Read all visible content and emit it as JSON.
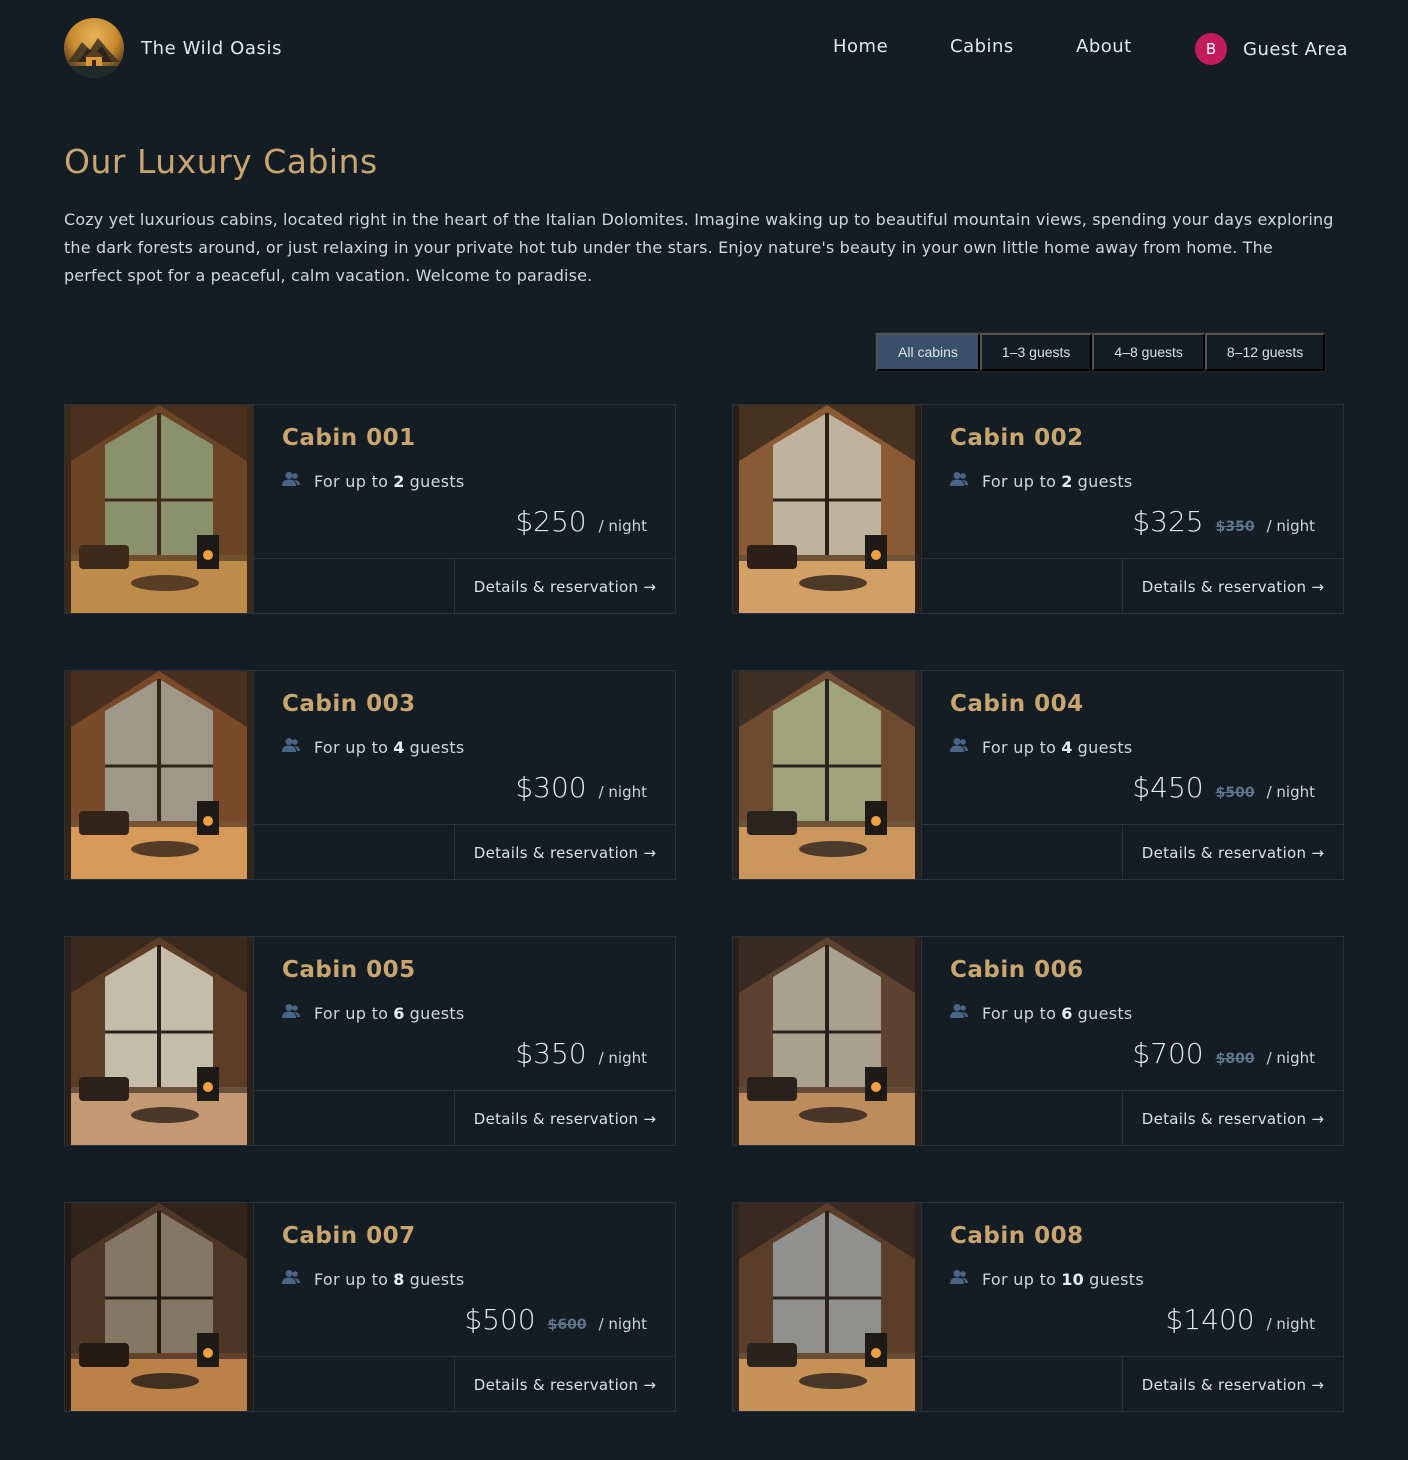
{
  "header": {
    "brand": "The Wild Oasis",
    "nav": [
      "Home",
      "Cabins",
      "About"
    ],
    "avatar_initial": "B",
    "guest_area": "Guest Area"
  },
  "main": {
    "title": "Our Luxury Cabins",
    "intro": "Cozy yet luxurious cabins, located right in the heart of the Italian Dolomites. Imagine waking up to beautiful mountain views, spending your days exploring the dark forests around, or just relaxing in your private hot tub under the stars. Enjoy nature's beauty in your own little home away from home. The perfect spot for a peaceful, calm vacation. Welcome to paradise."
  },
  "filter": {
    "options": [
      "All cabins",
      "1–3 guests",
      "4–8 guests",
      "8–12 guests"
    ],
    "active": "All cabins"
  },
  "labels": {
    "capacity_prefix": "For up to",
    "capacity_suffix": "guests",
    "per_night": "/ night",
    "details": "Details & reservation →"
  },
  "cabins": [
    {
      "name": "Cabin 001",
      "max_guests": "2",
      "price": "$250",
      "old_price": ""
    },
    {
      "name": "Cabin 002",
      "max_guests": "2",
      "price": "$325",
      "old_price": "$350"
    },
    {
      "name": "Cabin 003",
      "max_guests": "4",
      "price": "$300",
      "old_price": ""
    },
    {
      "name": "Cabin 004",
      "max_guests": "4",
      "price": "$450",
      "old_price": "$500"
    },
    {
      "name": "Cabin 005",
      "max_guests": "6",
      "price": "$350",
      "old_price": ""
    },
    {
      "name": "Cabin 006",
      "max_guests": "6",
      "price": "$700",
      "old_price": "$800"
    },
    {
      "name": "Cabin 007",
      "max_guests": "8",
      "price": "$500",
      "old_price": "$600"
    },
    {
      "name": "Cabin 008",
      "max_guests": "10",
      "price": "$1400",
      "old_price": ""
    }
  ],
  "colors": {
    "background": "#141c24",
    "accent": "#c9a670",
    "active_filter": "#3a5068",
    "avatar": "#c41c5a",
    "strike_price": "#60758c"
  }
}
